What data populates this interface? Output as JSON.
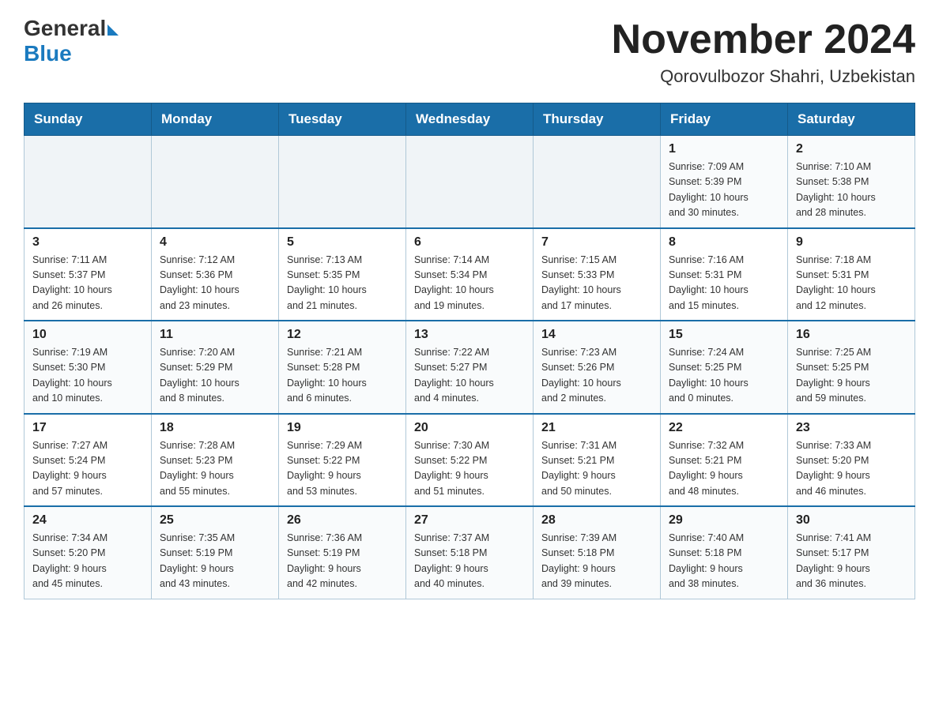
{
  "header": {
    "logo_general": "General",
    "logo_blue": "Blue",
    "title": "November 2024",
    "subtitle": "Qorovulbozor Shahri, Uzbekistan"
  },
  "days_of_week": [
    "Sunday",
    "Monday",
    "Tuesday",
    "Wednesday",
    "Thursday",
    "Friday",
    "Saturday"
  ],
  "weeks": [
    [
      {
        "day": "",
        "info": ""
      },
      {
        "day": "",
        "info": ""
      },
      {
        "day": "",
        "info": ""
      },
      {
        "day": "",
        "info": ""
      },
      {
        "day": "",
        "info": ""
      },
      {
        "day": "1",
        "info": "Sunrise: 7:09 AM\nSunset: 5:39 PM\nDaylight: 10 hours\nand 30 minutes."
      },
      {
        "day": "2",
        "info": "Sunrise: 7:10 AM\nSunset: 5:38 PM\nDaylight: 10 hours\nand 28 minutes."
      }
    ],
    [
      {
        "day": "3",
        "info": "Sunrise: 7:11 AM\nSunset: 5:37 PM\nDaylight: 10 hours\nand 26 minutes."
      },
      {
        "day": "4",
        "info": "Sunrise: 7:12 AM\nSunset: 5:36 PM\nDaylight: 10 hours\nand 23 minutes."
      },
      {
        "day": "5",
        "info": "Sunrise: 7:13 AM\nSunset: 5:35 PM\nDaylight: 10 hours\nand 21 minutes."
      },
      {
        "day": "6",
        "info": "Sunrise: 7:14 AM\nSunset: 5:34 PM\nDaylight: 10 hours\nand 19 minutes."
      },
      {
        "day": "7",
        "info": "Sunrise: 7:15 AM\nSunset: 5:33 PM\nDaylight: 10 hours\nand 17 minutes."
      },
      {
        "day": "8",
        "info": "Sunrise: 7:16 AM\nSunset: 5:31 PM\nDaylight: 10 hours\nand 15 minutes."
      },
      {
        "day": "9",
        "info": "Sunrise: 7:18 AM\nSunset: 5:31 PM\nDaylight: 10 hours\nand 12 minutes."
      }
    ],
    [
      {
        "day": "10",
        "info": "Sunrise: 7:19 AM\nSunset: 5:30 PM\nDaylight: 10 hours\nand 10 minutes."
      },
      {
        "day": "11",
        "info": "Sunrise: 7:20 AM\nSunset: 5:29 PM\nDaylight: 10 hours\nand 8 minutes."
      },
      {
        "day": "12",
        "info": "Sunrise: 7:21 AM\nSunset: 5:28 PM\nDaylight: 10 hours\nand 6 minutes."
      },
      {
        "day": "13",
        "info": "Sunrise: 7:22 AM\nSunset: 5:27 PM\nDaylight: 10 hours\nand 4 minutes."
      },
      {
        "day": "14",
        "info": "Sunrise: 7:23 AM\nSunset: 5:26 PM\nDaylight: 10 hours\nand 2 minutes."
      },
      {
        "day": "15",
        "info": "Sunrise: 7:24 AM\nSunset: 5:25 PM\nDaylight: 10 hours\nand 0 minutes."
      },
      {
        "day": "16",
        "info": "Sunrise: 7:25 AM\nSunset: 5:25 PM\nDaylight: 9 hours\nand 59 minutes."
      }
    ],
    [
      {
        "day": "17",
        "info": "Sunrise: 7:27 AM\nSunset: 5:24 PM\nDaylight: 9 hours\nand 57 minutes."
      },
      {
        "day": "18",
        "info": "Sunrise: 7:28 AM\nSunset: 5:23 PM\nDaylight: 9 hours\nand 55 minutes."
      },
      {
        "day": "19",
        "info": "Sunrise: 7:29 AM\nSunset: 5:22 PM\nDaylight: 9 hours\nand 53 minutes."
      },
      {
        "day": "20",
        "info": "Sunrise: 7:30 AM\nSunset: 5:22 PM\nDaylight: 9 hours\nand 51 minutes."
      },
      {
        "day": "21",
        "info": "Sunrise: 7:31 AM\nSunset: 5:21 PM\nDaylight: 9 hours\nand 50 minutes."
      },
      {
        "day": "22",
        "info": "Sunrise: 7:32 AM\nSunset: 5:21 PM\nDaylight: 9 hours\nand 48 minutes."
      },
      {
        "day": "23",
        "info": "Sunrise: 7:33 AM\nSunset: 5:20 PM\nDaylight: 9 hours\nand 46 minutes."
      }
    ],
    [
      {
        "day": "24",
        "info": "Sunrise: 7:34 AM\nSunset: 5:20 PM\nDaylight: 9 hours\nand 45 minutes."
      },
      {
        "day": "25",
        "info": "Sunrise: 7:35 AM\nSunset: 5:19 PM\nDaylight: 9 hours\nand 43 minutes."
      },
      {
        "day": "26",
        "info": "Sunrise: 7:36 AM\nSunset: 5:19 PM\nDaylight: 9 hours\nand 42 minutes."
      },
      {
        "day": "27",
        "info": "Sunrise: 7:37 AM\nSunset: 5:18 PM\nDaylight: 9 hours\nand 40 minutes."
      },
      {
        "day": "28",
        "info": "Sunrise: 7:39 AM\nSunset: 5:18 PM\nDaylight: 9 hours\nand 39 minutes."
      },
      {
        "day": "29",
        "info": "Sunrise: 7:40 AM\nSunset: 5:18 PM\nDaylight: 9 hours\nand 38 minutes."
      },
      {
        "day": "30",
        "info": "Sunrise: 7:41 AM\nSunset: 5:17 PM\nDaylight: 9 hours\nand 36 minutes."
      }
    ]
  ]
}
